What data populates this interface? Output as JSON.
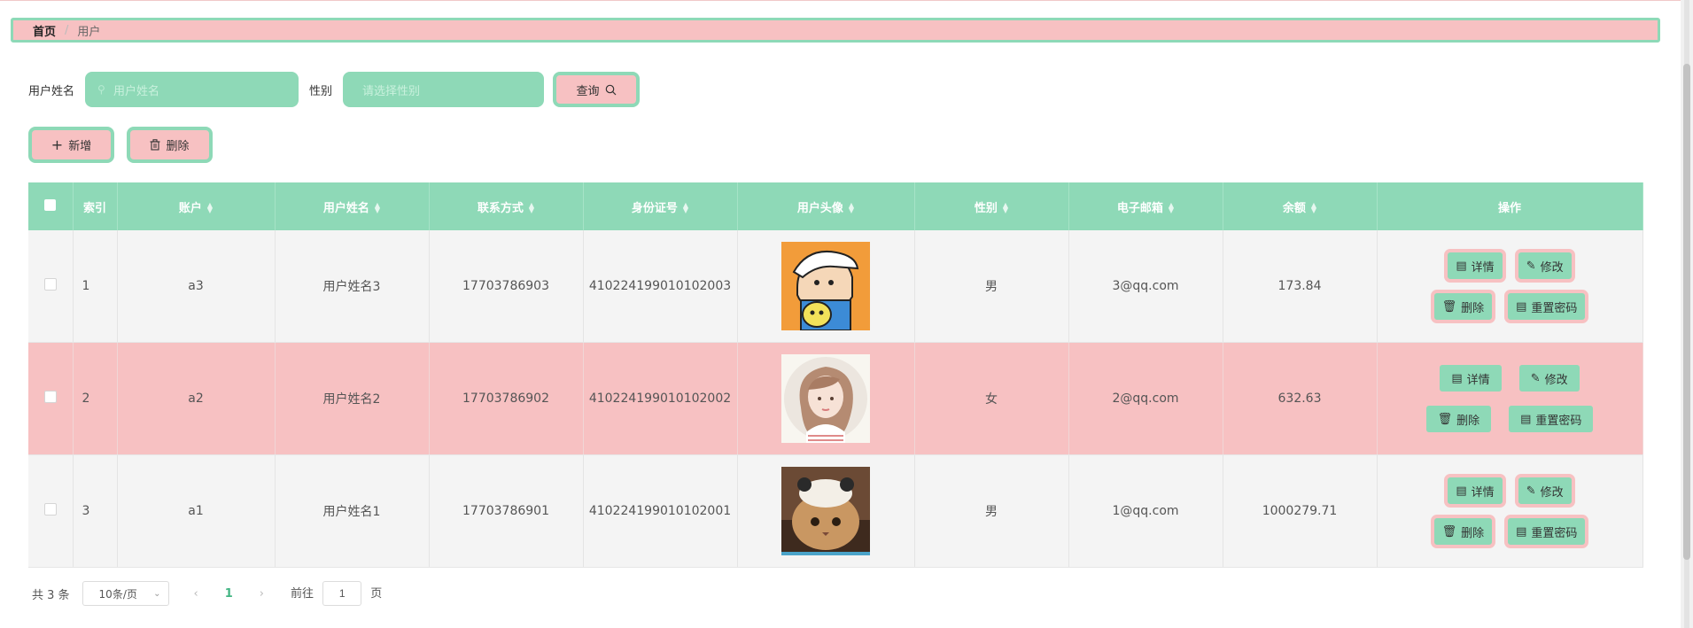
{
  "breadcrumb": {
    "home": "首页",
    "separator": "/",
    "current": "用户"
  },
  "search": {
    "name_label": "用户姓名",
    "name_placeholder": "用户姓名",
    "gender_label": "性别",
    "gender_placeholder": "请选择性别",
    "query_button": "查询"
  },
  "toolbar": {
    "add_button": "新增",
    "delete_button": "删除"
  },
  "table": {
    "headers": [
      "索引",
      "账户",
      "用户姓名",
      "联系方式",
      "身份证号",
      "用户头像",
      "性别",
      "电子邮箱",
      "余额",
      "操作"
    ],
    "rows": [
      {
        "index": "1",
        "account": "a3",
        "name": "用户姓名3",
        "phone": "17703786903",
        "id_card": "410224199010102003",
        "avatar": "cartoon-boy-avatar",
        "gender": "男",
        "email": "3@qq.com",
        "balance": "173.84"
      },
      {
        "index": "2",
        "account": "a2",
        "name": "用户姓名2",
        "phone": "17703786902",
        "id_card": "410224199010102002",
        "avatar": "girl-illustration-avatar",
        "gender": "女",
        "email": "2@qq.com",
        "balance": "632.63"
      },
      {
        "index": "3",
        "account": "a1",
        "name": "用户姓名1",
        "phone": "17703786901",
        "id_card": "410224199010102001",
        "avatar": "cat-photo-avatar",
        "gender": "男",
        "email": "1@qq.com",
        "balance": "1000279.71"
      }
    ],
    "row_actions": {
      "detail": "详情",
      "edit": "修改",
      "delete": "删除",
      "reset_password": "重置密码"
    }
  },
  "pagination": {
    "total": "共 3 条",
    "page_size": "10条/页",
    "current_page": "1",
    "goto_prefix": "前往",
    "goto_value": "1",
    "goto_suffix": "页"
  },
  "colors": {
    "green": "#8ed9b7",
    "pink": "#f7c1c2",
    "active_page": "#43b583"
  }
}
